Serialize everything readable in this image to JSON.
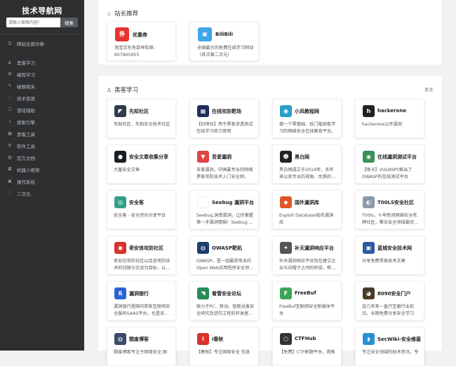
{
  "sidebar": {
    "brand": "技术导航网",
    "search_placeholder": "请输入搜索内容！",
    "search_button": "搜索",
    "all_categories": "网站全部分类",
    "items": [
      {
        "label": "黑客学习",
        "icon": "terminal-icon"
      },
      {
        "label": "编程学习",
        "icon": "code-icon"
      },
      {
        "label": "破解相关",
        "icon": "unlock-icon"
      },
      {
        "label": "技术资源",
        "icon": "resource-icon"
      },
      {
        "label": "游戏辅助",
        "icon": "gamepad-icon"
      },
      {
        "label": "搜索引擎",
        "icon": "search-icon"
      },
      {
        "label": "黑客工具",
        "icon": "grid-icon"
      },
      {
        "label": "软件工具",
        "icon": "gear-icon"
      },
      {
        "label": "官方文档",
        "icon": "document-icon"
      },
      {
        "label": "机器人框架",
        "icon": "robot-icon"
      },
      {
        "label": "操作系统",
        "icon": "os-icon"
      },
      {
        "label": "二次元",
        "icon": "heart-icon"
      }
    ]
  },
  "recommend": {
    "title": "站长推荐",
    "icon": "flame-icon",
    "cards": [
      {
        "name": "优惠券",
        "logo_text": "券",
        "logo_color": "#e8342f",
        "desc": "淘宝京东免单神车群：607865955"
      },
      {
        "name": "BiliBili",
        "logo_text": "▣",
        "logo_color": "#3fa6e8",
        "desc": "全国最大的免费在线学习网站（其次兼二次元）"
      }
    ]
  },
  "hacker": {
    "title": "黑客学习",
    "icon": "hacker-icon",
    "more": "更多",
    "cards": [
      {
        "name": "先知社区",
        "logo_text": "◤",
        "logo_color": "#2f3a4a",
        "desc": "先知社区，先知安全技术社区"
      },
      {
        "name": "在线攻防靶场",
        "logo_text": "▦",
        "logo_color": "#1f2f5a",
        "desc": "【封神台】用于黑客渗透测试在线学习练习使用"
      },
      {
        "name": "小风教程网",
        "logo_text": "◉",
        "logo_color": "#2aa0c8",
        "desc": "做一个零基础、低门槛就能学习的网络安全在线教育平台。"
      },
      {
        "name": "hackerone",
        "logo_text": "h",
        "logo_color": "#222222",
        "desc": "hackerone公开漏洞"
      },
      {
        "name": "安全文章收集分享",
        "logo_text": "●",
        "logo_color": "#1b1f23",
        "desc": "大量安全文章"
      },
      {
        "name": "吾爱漏洞",
        "logo_text": "▼",
        "logo_color": "#e04343",
        "desc": "吾爱漏洞，中国最专业的网络黑客攻防技术入门安全网，"
      },
      {
        "name": "黑白网",
        "logo_text": "☻",
        "logo_color": "#222222",
        "desc": "黑白网成立于2014年，多年来以其专业的视角，优质的..."
      },
      {
        "name": "在线漏洞测试平台",
        "logo_text": "◉",
        "logo_color": "#3a8f5a",
        "desc": "【暗卡】VULNSPY推出了OWASP的在线测试平台"
      },
      {
        "name": "安全客",
        "logo_text": "◎",
        "logo_color": "#35a08a",
        "desc": "安全客 - 安全资讯分享平台"
      },
      {
        "name": "Seebug 漏洞平台",
        "logo_text": "",
        "logo_color": "#ffffff",
        "desc": "Seebug,洞悉漏洞，让你掌握第一手漏洞情报！Seebug ..."
      },
      {
        "name": "国外漏洞库",
        "logo_text": "◆",
        "logo_color": "#e0562a",
        "desc": "Exploit Database知名漏洞库"
      },
      {
        "name": "T00LS安全社区",
        "logo_text": "◐",
        "logo_color": "#8a9aa8",
        "desc": "T00ls，十年民间网络安全老牌社区，聚合安全领域最优..."
      },
      {
        "name": "奇安信攻防社区",
        "logo_text": "◉",
        "logo_color": "#d8322c",
        "desc": "奇安信攻防社区以促进攻防技术的切磋与交流为目标，以..."
      },
      {
        "name": "OWASP靶机",
        "logo_text": "◍",
        "logo_color": "#1d3d6b",
        "desc": "OWASP，是一组最受攻击的Open Web应用程序安全项..."
      },
      {
        "name": "补天漏洞响应平台",
        "logo_text": "✦",
        "logo_color": "#555555",
        "desc": "补天漏洞响应平台旨在建立企业与白帽子之间的桥梁，帮..."
      },
      {
        "name": "蓝城安全技术网",
        "logo_text": "▣",
        "logo_color": "#2c5aa0",
        "desc": "分享免费黑客技术文章"
      },
      {
        "name": "漏洞银行",
        "logo_text": "ß",
        "logo_color": "#2a64d8",
        "desc": "漏洞银行是国内首家互联网安全服务SAAS平台，也是安..."
      },
      {
        "name": "看雪安全论坛",
        "logo_text": "◥",
        "logo_color": "#2b8a57",
        "desc": "致力于PC、移动、智能设备安全研究及逆向工程的开发者..."
      },
      {
        "name": "FreeBuf",
        "logo_text": "F",
        "logo_color": "#3fa55a",
        "desc": "FreeBuf互联网安全新媒体平台"
      },
      {
        "name": "8090安全门户",
        "logo_text": "◕",
        "logo_color": "#4a3a2a",
        "desc": "这几年来一直行至跟行业前沿，长期免费分享安全学习资..."
      },
      {
        "name": "颓废博客",
        "logo_text": "◍",
        "logo_color": "#3a4a6a",
        "desc": "颓废博客专注于网络安全,图"
      },
      {
        "name": "i春秋",
        "logo_text": "i",
        "logo_color": "#d8322c",
        "desc": "【春秋】专注网络安全 信息"
      },
      {
        "name": "CTFHub",
        "logo_text": "⬡",
        "logo_color": "#333333",
        "desc": "【免费】CTF刷题平台，首推"
      },
      {
        "name": "SecWiki-安全维基",
        "logo_text": "◗",
        "logo_color": "#2a8fd0",
        "desc": "专注安全领域的技术资讯，专"
      }
    ]
  }
}
